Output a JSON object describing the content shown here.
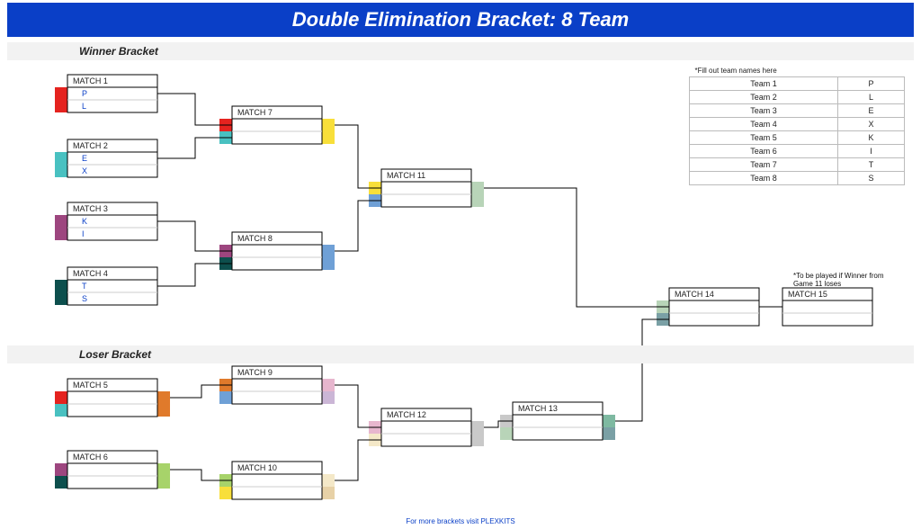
{
  "title": "Double Elimination Bracket: 8 Team",
  "sections": {
    "winner": "Winner Bracket",
    "loser": "Loser Bracket"
  },
  "roster_note": "*Fill out team names here",
  "roster": [
    {
      "label": "Team 1",
      "name": "P"
    },
    {
      "label": "Team 2",
      "name": "L"
    },
    {
      "label": "Team 3",
      "name": "E"
    },
    {
      "label": "Team 4",
      "name": "X"
    },
    {
      "label": "Team 5",
      "name": "K"
    },
    {
      "label": "Team 6",
      "name": "I"
    },
    {
      "label": "Team 7",
      "name": "T"
    },
    {
      "label": "Team 8",
      "name": "S"
    }
  ],
  "m15_caption": "*To be played if Winner from Game 11 loses",
  "footer": "For more brackets visit PLEXKITS",
  "matches": {
    "m1": {
      "label": "MATCH 1",
      "a": "P",
      "b": "L"
    },
    "m2": {
      "label": "MATCH 2",
      "a": "E",
      "b": "X"
    },
    "m3": {
      "label": "MATCH 3",
      "a": "K",
      "b": "I"
    },
    "m4": {
      "label": "MATCH 4",
      "a": "T",
      "b": "S"
    },
    "m5": {
      "label": "MATCH 5",
      "a": "",
      "b": ""
    },
    "m6": {
      "label": "MATCH 6",
      "a": "",
      "b": ""
    },
    "m7": {
      "label": "MATCH 7",
      "a": "",
      "b": ""
    },
    "m8": {
      "label": "MATCH 8",
      "a": "",
      "b": ""
    },
    "m9": {
      "label": "MATCH 9",
      "a": "",
      "b": ""
    },
    "m10": {
      "label": "MATCH 10",
      "a": "",
      "b": ""
    },
    "m11": {
      "label": "MATCH 11",
      "a": "",
      "b": ""
    },
    "m12": {
      "label": "MATCH 12",
      "a": "",
      "b": ""
    },
    "m13": {
      "label": "MATCH 13",
      "a": "",
      "b": ""
    },
    "m14": {
      "label": "MATCH 14",
      "a": "",
      "b": ""
    },
    "m15": {
      "label": "MATCH 15",
      "a": "",
      "b": ""
    }
  },
  "colors": {
    "red": "#e5231f",
    "cyan": "#49c1c1",
    "purple": "#9d467f",
    "teal": "#1e6f70",
    "darkteal": "#0d4f4d",
    "lightteal": "#4c9ba0",
    "orange": "#e07a2b",
    "green": "#a7d36a",
    "yellow": "#f8df3a",
    "blue": "#6fa0d6",
    "sage": "#b8d4b8",
    "grey": "#c9c9c9",
    "pale": "#e7d1a7",
    "lav": "#cbb6d6",
    "cream": "#f4e8c8",
    "rose": "#e7b6ce",
    "slate": "#7aa0a5",
    "olive": "#9cb57c",
    "seafoam": "#7eb9a1"
  }
}
